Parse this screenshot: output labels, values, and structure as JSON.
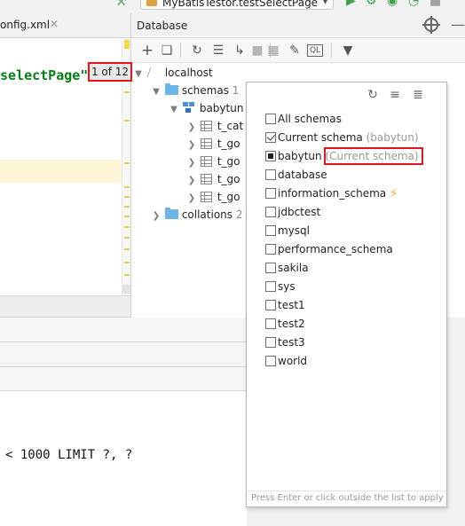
{
  "run_config": {
    "label": "MyBatisTestor.testSelectPage"
  },
  "editor": {
    "tab_label": "onfig.xml",
    "code_line": "selectPage\")",
    "code_semicolon": ";"
  },
  "console": {
    "sql_line": "< 1000 LIMIT ?, ?"
  },
  "database": {
    "title": "Database",
    "tree": {
      "host": "localhost",
      "schemas_label": "schemas",
      "schemas_count": "1",
      "schema_name": "babytun",
      "tables": [
        "t_cat",
        "t_go",
        "t_go",
        "t_go",
        "t_go"
      ],
      "collations_label": "collations",
      "collations_count": "2"
    }
  },
  "count_badge": "1 of 12",
  "popup": {
    "options": [
      {
        "label": "All schemas",
        "state": "unchecked",
        "hint": ""
      },
      {
        "label": "Current schema",
        "state": "checked",
        "hint": "(babytun)"
      },
      {
        "label": "babytun",
        "state": "partial",
        "hint": "(Current schema)"
      },
      {
        "label": "database",
        "state": "unchecked",
        "hint": ""
      },
      {
        "label": "information_schema",
        "state": "unchecked",
        "hint": "",
        "icon": "lightning-icon"
      },
      {
        "label": "jdbctest",
        "state": "unchecked",
        "hint": ""
      },
      {
        "label": "mysql",
        "state": "unchecked",
        "hint": ""
      },
      {
        "label": "performance_schema",
        "state": "unchecked",
        "hint": ""
      },
      {
        "label": "sakila",
        "state": "unchecked",
        "hint": ""
      },
      {
        "label": "sys",
        "state": "unchecked",
        "hint": ""
      },
      {
        "label": "test1",
        "state": "unchecked",
        "hint": ""
      },
      {
        "label": "test2",
        "state": "unchecked",
        "hint": ""
      },
      {
        "label": "test3",
        "state": "unchecked",
        "hint": ""
      },
      {
        "label": "world",
        "state": "unchecked",
        "hint": ""
      }
    ],
    "footer": "Press Enter or click outside the list to apply"
  },
  "colors": {
    "highlight_red": "#e5141c",
    "folder_blue": "#6cb5e6",
    "string_green": "#067d17",
    "bolt_orange": "#f5a623"
  }
}
